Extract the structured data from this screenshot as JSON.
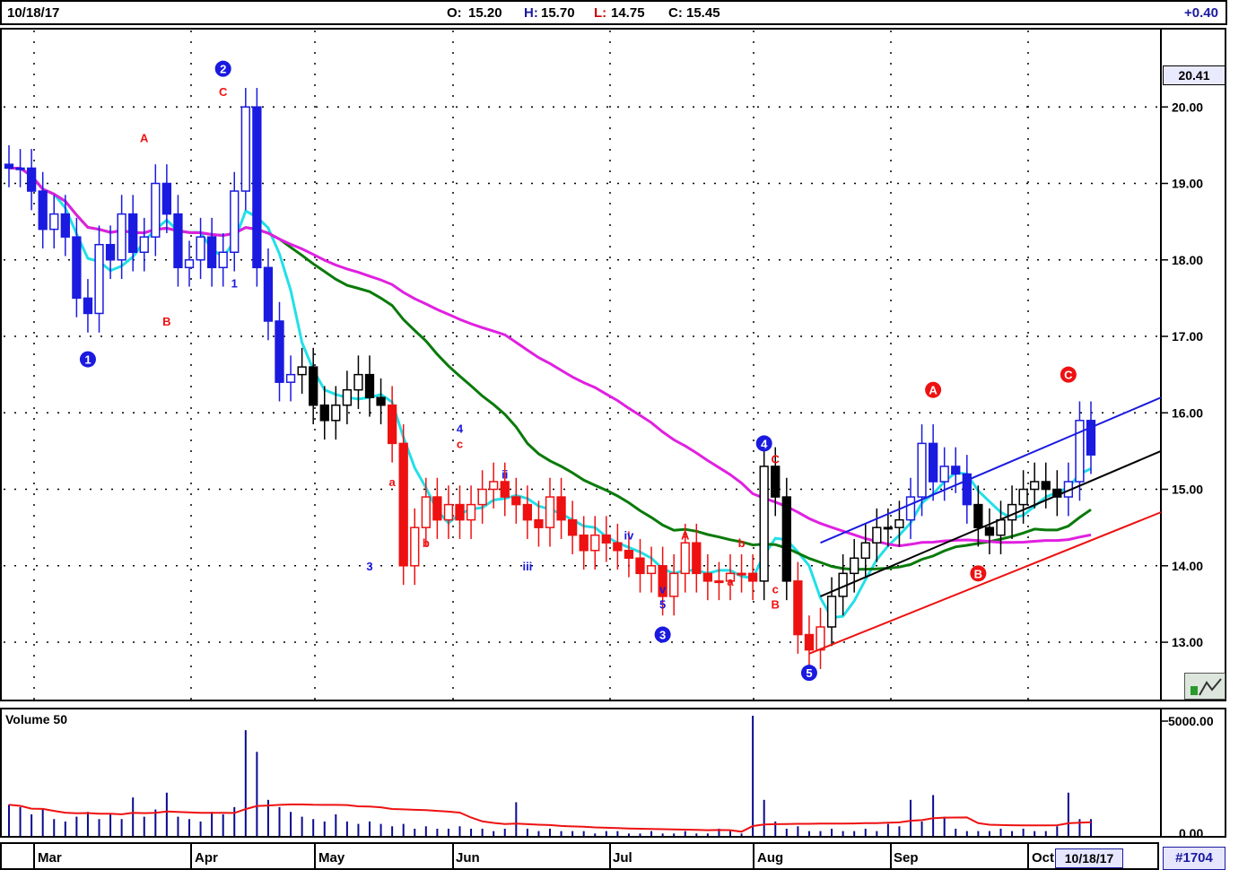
{
  "header": {
    "date": "10/18/17",
    "open_label": "O:",
    "open": "15.20",
    "high_label": "H:",
    "high": "15.70",
    "low_label": "L:",
    "low": "14.75",
    "close_label": "C:",
    "close": "15.45",
    "change": "+0.40"
  },
  "last_price": "20.41",
  "date_box": "10/18/17",
  "symbol_id": "#1704",
  "volume_label": "Volume 50",
  "volume_axis": {
    "max": "5000.00",
    "min": "0.00"
  },
  "months": [
    "Mar",
    "Apr",
    "May",
    "Jun",
    "Jul",
    "Aug",
    "Sep",
    "Oct"
  ],
  "colors": {
    "up_blue": "#1a1ae0",
    "down_red": "#ee1111",
    "neutral": "#000000",
    "ma_cyan": "#22e0e8",
    "ma_green": "#0a7a0a",
    "ma_magenta": "#e020e0",
    "trend_red": "#ee1111",
    "trend_blue": "#1a1ae0",
    "trend_black": "#000000"
  },
  "chart_data": {
    "type": "line",
    "title": "",
    "ylim": [
      12.25,
      21.0
    ],
    "yticks": [
      "13.00",
      "14.00",
      "15.00",
      "16.00",
      "17.00",
      "18.00",
      "19.00",
      "20.00"
    ],
    "close_series": [
      19.2,
      19.2,
      18.9,
      18.4,
      18.6,
      18.3,
      17.5,
      17.3,
      18.2,
      18.0,
      18.6,
      18.1,
      18.3,
      19.0,
      18.6,
      17.9,
      18.0,
      18.3,
      17.9,
      18.1,
      18.9,
      20.0,
      17.9,
      17.2,
      16.4,
      16.5,
      16.6,
      16.1,
      15.9,
      16.1,
      16.3,
      16.5,
      16.2,
      16.1,
      15.6,
      14.0,
      14.5,
      14.9,
      14.6,
      14.8,
      14.6,
      14.8,
      15.0,
      15.1,
      14.9,
      14.8,
      14.6,
      14.5,
      14.9,
      14.6,
      14.4,
      14.2,
      14.4,
      14.3,
      14.2,
      14.1,
      13.9,
      14.0,
      13.6,
      13.9,
      14.3,
      13.9,
      13.8,
      13.8,
      13.9,
      13.9,
      13.8,
      15.3,
      14.9,
      13.8,
      13.1,
      12.9,
      13.2,
      13.6,
      13.9,
      14.1,
      14.3,
      14.5,
      14.5,
      14.6,
      14.9,
      15.6,
      15.1,
      15.3,
      15.2,
      14.8,
      14.5,
      14.4,
      14.6,
      14.8,
      15.0,
      15.1,
      15.0,
      14.9,
      15.1,
      15.9,
      15.45
    ],
    "moving_averages": [
      {
        "name": "",
        "color": "cyan"
      },
      {
        "name": "",
        "color": "green"
      },
      {
        "name": "",
        "color": "magenta"
      }
    ],
    "wave_labels": [
      {
        "text": "1",
        "circled": true,
        "color": "blue"
      },
      {
        "text": "2",
        "circled": true,
        "color": "blue"
      },
      {
        "text": "3",
        "circled": true,
        "color": "blue"
      },
      {
        "text": "4",
        "circled": true,
        "color": "blue"
      },
      {
        "text": "5",
        "circled": true,
        "color": "blue"
      },
      {
        "text": "A",
        "circled": true,
        "color": "red"
      },
      {
        "text": "B",
        "circled": true,
        "color": "red"
      },
      {
        "text": "C",
        "circled": true,
        "color": "red"
      },
      {
        "text": "A",
        "circled": false,
        "color": "red"
      },
      {
        "text": "B",
        "circled": false,
        "color": "red"
      },
      {
        "text": "C",
        "circled": false,
        "color": "red"
      },
      {
        "text": "3",
        "circled": false,
        "color": "blue"
      },
      {
        "text": "4",
        "circled": false,
        "color": "blue"
      },
      {
        "text": "a",
        "circled": false,
        "color": "red"
      },
      {
        "text": "b",
        "circled": false,
        "color": "red"
      },
      {
        "text": "c",
        "circled": false,
        "color": "red"
      },
      {
        "text": "ii",
        "circled": false,
        "color": "blue"
      },
      {
        "text": "iii",
        "circled": false,
        "color": "blue"
      },
      {
        "text": "iv",
        "circled": false,
        "color": "blue"
      },
      {
        "text": "v",
        "circled": false,
        "color": "blue"
      },
      {
        "text": "5",
        "circled": false,
        "color": "blue"
      },
      {
        "text": "1",
        "circled": false,
        "color": "blue"
      },
      {
        "text": "A",
        "circled": false,
        "color": "red"
      },
      {
        "text": "a",
        "circled": false,
        "color": "red"
      },
      {
        "text": "b",
        "circled": false,
        "color": "red"
      },
      {
        "text": "c",
        "circled": false,
        "color": "red"
      },
      {
        "text": "B",
        "circled": false,
        "color": "red"
      },
      {
        "text": "C",
        "circled": false,
        "color": "red"
      }
    ],
    "volume_series": [
      1300,
      1200,
      900,
      1100,
      700,
      600,
      800,
      1000,
      700,
      900,
      700,
      1600,
      800,
      1100,
      1800,
      800,
      700,
      600,
      1000,
      900,
      1200,
      4400,
      3500,
      1500,
      1200,
      1000,
      800,
      700,
      600,
      900,
      600,
      500,
      600,
      500,
      400,
      500,
      300,
      400,
      300,
      300,
      400,
      300,
      300,
      200,
      300,
      1400,
      300,
      200,
      300,
      200,
      200,
      200,
      100,
      200,
      200,
      100,
      100,
      200,
      100,
      100,
      200,
      100,
      100,
      300,
      200,
      100,
      5000,
      1500,
      600,
      300,
      400,
      200,
      200,
      300,
      200,
      200,
      300,
      200,
      500,
      400,
      1500,
      600,
      1700,
      800,
      300,
      200,
      200,
      200,
      300,
      200,
      300,
      200,
      200,
      400,
      1800,
      700,
      700
    ]
  }
}
